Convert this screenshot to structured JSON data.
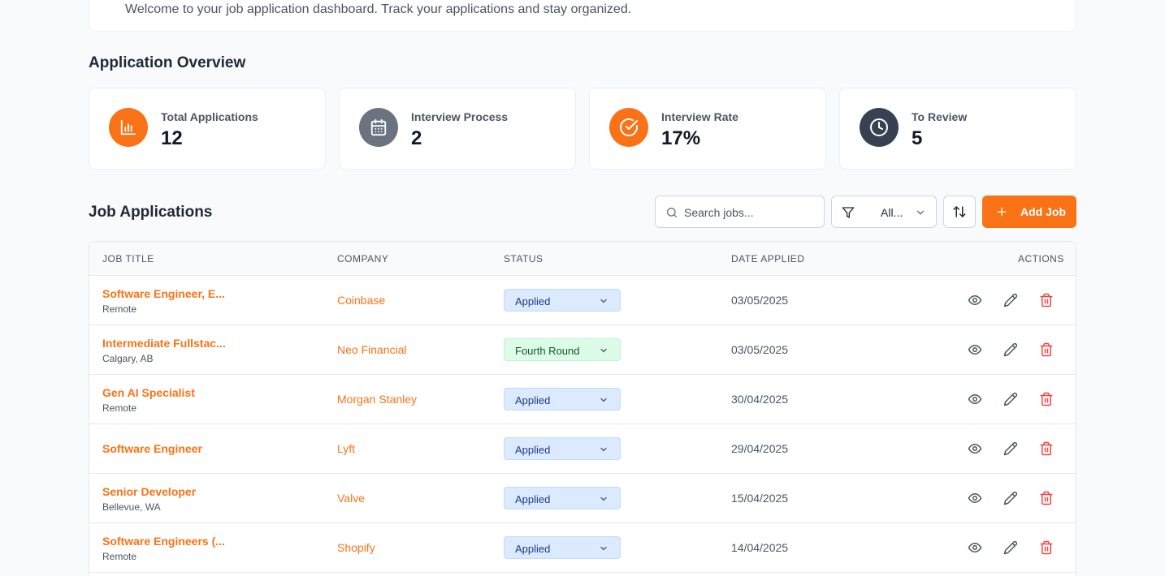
{
  "welcome": "Welcome to your job application dashboard. Track your applications and stay organized.",
  "overview": {
    "title": "Application Overview",
    "stats": [
      {
        "label": "Total Applications",
        "value": "12",
        "icon": "bar-chart-icon",
        "color": "#f97316"
      },
      {
        "label": "Interview Process",
        "value": "2",
        "icon": "calendar-icon",
        "color": "#6b7280"
      },
      {
        "label": "Interview Rate",
        "value": "17%",
        "icon": "check-circle-icon",
        "color": "#f97316"
      },
      {
        "label": "To Review",
        "value": "5",
        "icon": "clock-icon",
        "color": "#374151"
      }
    ]
  },
  "jobs": {
    "title": "Job Applications",
    "search_placeholder": "Search jobs...",
    "filter_value": "All...",
    "add_label": "Add Job",
    "columns": [
      "JOB TITLE",
      "COMPANY",
      "STATUS",
      "DATE APPLIED",
      "ACTIONS"
    ],
    "rows": [
      {
        "title": "Software Engineer, E...",
        "location": "Remote",
        "company": "Coinbase",
        "status": "Applied",
        "date": "03/05/2025"
      },
      {
        "title": "Intermediate Fullstac...",
        "location": "Calgary, AB",
        "company": "Neo Financial",
        "status": "Fourth Round",
        "date": "03/05/2025"
      },
      {
        "title": "Gen AI Specialist",
        "location": "Remote",
        "company": "Morgan Stanley",
        "status": "Applied",
        "date": "30/04/2025"
      },
      {
        "title": "Software Engineer",
        "location": "",
        "company": "Lyft",
        "status": "Applied",
        "date": "29/04/2025"
      },
      {
        "title": "Senior Developer",
        "location": "Bellevue, WA",
        "company": "Valve",
        "status": "Applied",
        "date": "15/04/2025"
      },
      {
        "title": "Software Engineers (...",
        "location": "Remote",
        "company": "Shopify",
        "status": "Applied",
        "date": "14/04/2025"
      }
    ]
  },
  "colors": {
    "accent": "#f97316",
    "delete": "#ef4444"
  }
}
